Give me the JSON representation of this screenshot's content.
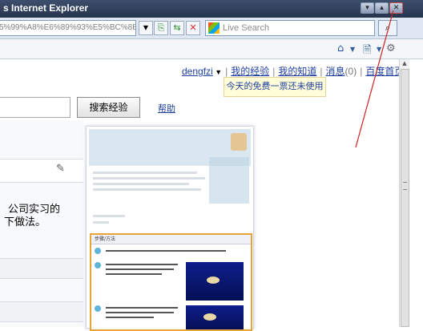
{
  "window": {
    "title": "s Internet Explorer",
    "controls": [
      "minimize",
      "maximize",
      "close"
    ]
  },
  "address_bar": {
    "url": "5%99%A8%E6%89%93%E5%BC%8B"
  },
  "search_box": {
    "placeholder": "Live Search"
  },
  "user_nav": {
    "username": "dengfzi",
    "links": [
      "我的经验",
      "我的知道",
      "消息",
      "百度首页"
    ],
    "message_count": "(0)"
  },
  "tooltip": {
    "text": "今天的免费一票还未使用"
  },
  "page_search": {
    "button_label": "搜索经验",
    "help_label": "帮助"
  },
  "article_snippet": {
    "line1": "公司实习的",
    "line2": "下做法。"
  },
  "thumbnail": {
    "section_title": "步骤/方法"
  },
  "colors": {
    "titlebar": "#2f3f5c",
    "link": "#1f3f9f",
    "annotation_line": "#cc2222"
  }
}
